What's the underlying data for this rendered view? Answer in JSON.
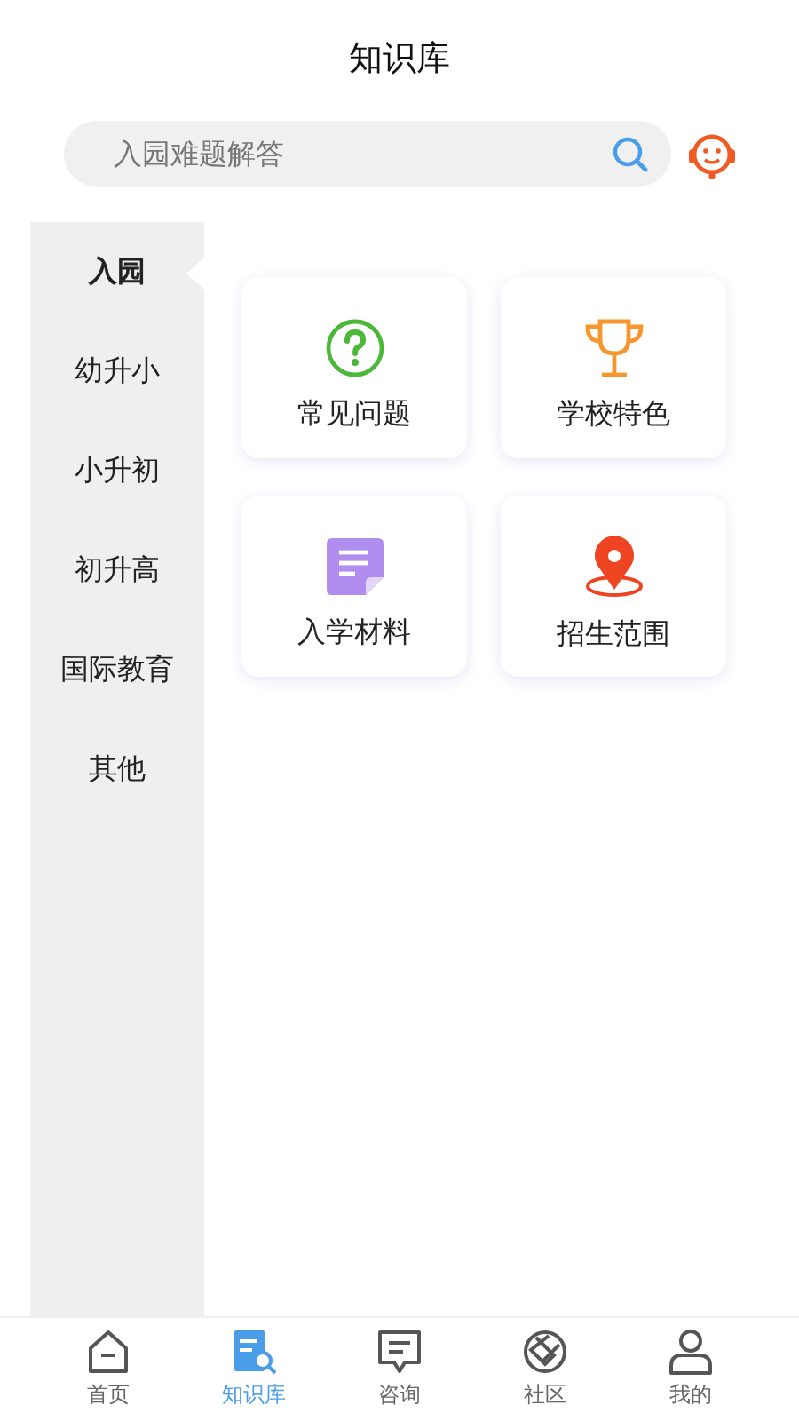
{
  "header": {
    "title": "知识库"
  },
  "search": {
    "placeholder": "入园难题解答"
  },
  "sidebar": {
    "items": [
      {
        "label": "入园",
        "selected": true
      },
      {
        "label": "幼升小",
        "selected": false
      },
      {
        "label": "小升初",
        "selected": false
      },
      {
        "label": "初升高",
        "selected": false
      },
      {
        "label": "国际教育",
        "selected": false
      },
      {
        "label": "其他",
        "selected": false
      }
    ]
  },
  "cards": [
    {
      "kind": "question",
      "label": "常见问题"
    },
    {
      "kind": "trophy",
      "label": "学校特色"
    },
    {
      "kind": "document",
      "label": "入学材料"
    },
    {
      "kind": "location",
      "label": "招生范围"
    }
  ],
  "tab_bar": [
    {
      "kind": "home",
      "label": "首页",
      "selected": false
    },
    {
      "kind": "knowledge",
      "label": "知识库",
      "selected": true
    },
    {
      "kind": "chat",
      "label": "咨询",
      "selected": false
    },
    {
      "kind": "community",
      "label": "社区",
      "selected": false
    },
    {
      "kind": "profile",
      "label": "我的",
      "selected": false
    }
  ]
}
